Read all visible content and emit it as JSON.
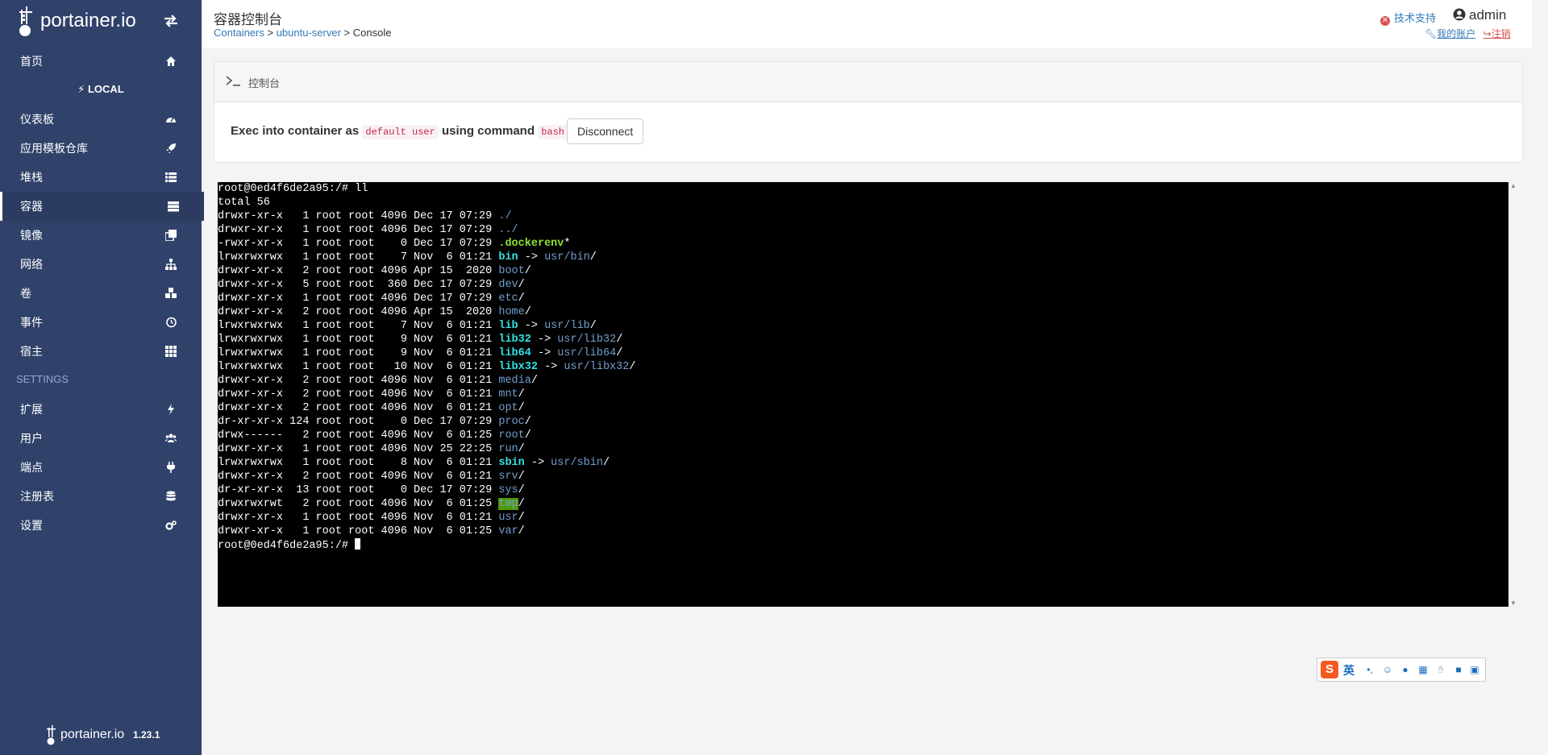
{
  "brand": {
    "logo_text": "portainer.io"
  },
  "sidebar": {
    "items": [
      {
        "label": "首页",
        "icon": "home-icon"
      },
      {
        "label": "仪表板",
        "icon": "tachometer-icon"
      },
      {
        "label": "应用模板仓库",
        "icon": "rocket-icon"
      },
      {
        "label": "堆栈",
        "icon": "th-list-icon"
      },
      {
        "label": "容器",
        "icon": "server-icon",
        "active": true
      },
      {
        "label": "镜像",
        "icon": "clone-icon"
      },
      {
        "label": "网络",
        "icon": "sitemap-icon"
      },
      {
        "label": "卷",
        "icon": "cubes-icon"
      },
      {
        "label": "事件",
        "icon": "history-icon"
      },
      {
        "label": "宿主",
        "icon": "th-icon"
      }
    ],
    "endpoint_label": "LOCAL",
    "settings_label": "SETTINGS",
    "settings_items": [
      {
        "label": "扩展",
        "icon": "bolt-icon"
      },
      {
        "label": "用户",
        "icon": "users-icon"
      },
      {
        "label": "端点",
        "icon": "plug-icon"
      },
      {
        "label": "注册表",
        "icon": "database-icon"
      },
      {
        "label": "设置",
        "icon": "cogs-icon"
      }
    ],
    "footer": {
      "text": "portainer.io",
      "version": "1.23.1"
    }
  },
  "header": {
    "title": "容器控制台",
    "breadcrumb": {
      "containers": "Containers",
      "sep1": " > ",
      "server": "ubuntu-server",
      "sep2": " > ",
      "current": "Console"
    },
    "support": "技术支持",
    "user": "admin",
    "my_account": "我的账户",
    "logout": "注销"
  },
  "widget": {
    "title": "控制台",
    "exec_prefix": "Exec into container as",
    "user_code": "default user",
    "exec_mid": "using command",
    "command_code": "bash",
    "disconnect": "Disconnect"
  },
  "terminal": {
    "lines": [
      [
        {
          "t": "root@0ed4f6de2a95:/# ll"
        }
      ],
      [
        {
          "t": "total 56"
        }
      ],
      [
        {
          "t": "drwxr-xr-x   1 root root 4096 Dec 17 07:29 "
        },
        {
          "t": "./",
          "c": "blue"
        }
      ],
      [
        {
          "t": "drwxr-xr-x   1 root root 4096 Dec 17 07:29 "
        },
        {
          "t": "../",
          "c": "blue"
        }
      ],
      [
        {
          "t": "-rwxr-xr-x   1 root root    0 Dec 17 07:29 "
        },
        {
          "t": ".dockerenv",
          "c": "green"
        },
        {
          "t": "*"
        }
      ],
      [
        {
          "t": "lrwxrwxrwx   1 root root    7 Nov  6 01:21 "
        },
        {
          "t": "bin",
          "c": "cyan"
        },
        {
          "t": " -> "
        },
        {
          "t": "usr/bin",
          "c": "blue"
        },
        {
          "t": "/"
        }
      ],
      [
        {
          "t": "drwxr-xr-x   2 root root 4096 Apr 15  2020 "
        },
        {
          "t": "boot",
          "c": "blue"
        },
        {
          "t": "/"
        }
      ],
      [
        {
          "t": "drwxr-xr-x   5 root root  360 Dec 17 07:29 "
        },
        {
          "t": "dev",
          "c": "blue"
        },
        {
          "t": "/"
        }
      ],
      [
        {
          "t": "drwxr-xr-x   1 root root 4096 Dec 17 07:29 "
        },
        {
          "t": "etc",
          "c": "blue"
        },
        {
          "t": "/"
        }
      ],
      [
        {
          "t": "drwxr-xr-x   2 root root 4096 Apr 15  2020 "
        },
        {
          "t": "home",
          "c": "blue"
        },
        {
          "t": "/"
        }
      ],
      [
        {
          "t": "lrwxrwxrwx   1 root root    7 Nov  6 01:21 "
        },
        {
          "t": "lib",
          "c": "cyan"
        },
        {
          "t": " -> "
        },
        {
          "t": "usr/lib",
          "c": "blue"
        },
        {
          "t": "/"
        }
      ],
      [
        {
          "t": "lrwxrwxrwx   1 root root    9 Nov  6 01:21 "
        },
        {
          "t": "lib32",
          "c": "cyan"
        },
        {
          "t": " -> "
        },
        {
          "t": "usr/lib32",
          "c": "blue"
        },
        {
          "t": "/"
        }
      ],
      [
        {
          "t": "lrwxrwxrwx   1 root root    9 Nov  6 01:21 "
        },
        {
          "t": "lib64",
          "c": "cyan"
        },
        {
          "t": " -> "
        },
        {
          "t": "usr/lib64",
          "c": "blue"
        },
        {
          "t": "/"
        }
      ],
      [
        {
          "t": "lrwxrwxrwx   1 root root   10 Nov  6 01:21 "
        },
        {
          "t": "libx32",
          "c": "cyan"
        },
        {
          "t": " -> "
        },
        {
          "t": "usr/libx32",
          "c": "blue"
        },
        {
          "t": "/"
        }
      ],
      [
        {
          "t": "drwxr-xr-x   2 root root 4096 Nov  6 01:21 "
        },
        {
          "t": "media",
          "c": "blue"
        },
        {
          "t": "/"
        }
      ],
      [
        {
          "t": "drwxr-xr-x   2 root root 4096 Nov  6 01:21 "
        },
        {
          "t": "mnt",
          "c": "blue"
        },
        {
          "t": "/"
        }
      ],
      [
        {
          "t": "drwxr-xr-x   2 root root 4096 Nov  6 01:21 "
        },
        {
          "t": "opt",
          "c": "blue"
        },
        {
          "t": "/"
        }
      ],
      [
        {
          "t": "dr-xr-xr-x 124 root root    0 Dec 17 07:29 "
        },
        {
          "t": "proc",
          "c": "blue"
        },
        {
          "t": "/"
        }
      ],
      [
        {
          "t": "drwx------   2 root root 4096 Nov  6 01:25 "
        },
        {
          "t": "root",
          "c": "blue"
        },
        {
          "t": "/"
        }
      ],
      [
        {
          "t": "drwxr-xr-x   1 root root 4096 Nov 25 22:25 "
        },
        {
          "t": "run",
          "c": "blue"
        },
        {
          "t": "/"
        }
      ],
      [
        {
          "t": "lrwxrwxrwx   1 root root    8 Nov  6 01:21 "
        },
        {
          "t": "sbin",
          "c": "cyan"
        },
        {
          "t": " -> "
        },
        {
          "t": "usr/sbin",
          "c": "blue"
        },
        {
          "t": "/"
        }
      ],
      [
        {
          "t": "drwxr-xr-x   2 root root 4096 Nov  6 01:21 "
        },
        {
          "t": "srv",
          "c": "blue"
        },
        {
          "t": "/"
        }
      ],
      [
        {
          "t": "dr-xr-xr-x  13 root root    0 Dec 17 07:29 "
        },
        {
          "t": "sys",
          "c": "blue"
        },
        {
          "t": "/"
        }
      ],
      [
        {
          "t": "drwxrwxrwt   2 root root 4096 Nov  6 01:25 "
        },
        {
          "t": "tmp",
          "c": "sticky"
        },
        {
          "t": "/"
        }
      ],
      [
        {
          "t": "drwxr-xr-x   1 root root 4096 Nov  6 01:21 "
        },
        {
          "t": "usr",
          "c": "blue"
        },
        {
          "t": "/"
        }
      ],
      [
        {
          "t": "drwxr-xr-x   1 root root 4096 Nov  6 01:25 "
        },
        {
          "t": "var",
          "c": "blue"
        },
        {
          "t": "/"
        }
      ],
      [
        {
          "t": "root@0ed4f6de2a95:/# "
        }
      ]
    ]
  },
  "ime": {
    "logo": "S",
    "lang": "英",
    "icons": [
      "punctuation-icon",
      "emoji-icon",
      "mic-icon",
      "keyboard-icon",
      "hand-icon",
      "skin-icon",
      "grid-icon"
    ]
  },
  "colors": {
    "sidebar_bg": "#30426a",
    "link": "#337ab7",
    "terminal_bg": "#000000"
  }
}
